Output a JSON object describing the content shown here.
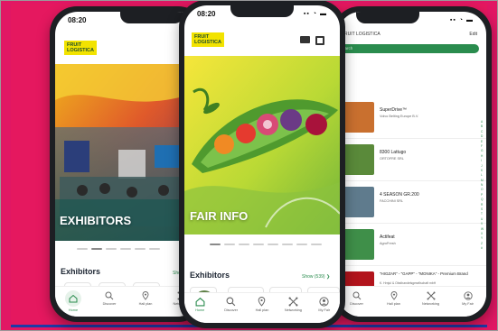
{
  "left_phone": {
    "time": "08:20",
    "logo": [
      "FRUIT",
      "LOGISTICA"
    ],
    "hero_title": "EXHIBITORS",
    "section_title": "Exhibitors",
    "show_link": "Show",
    "tabs": [
      {
        "label": "Home",
        "icon": "home-icon"
      },
      {
        "label": "Discover",
        "icon": "search-icon"
      },
      {
        "label": "Hall plan",
        "icon": "map-pin-icon"
      },
      {
        "label": "Networking",
        "icon": "networking-icon"
      }
    ]
  },
  "center_phone": {
    "time": "08:20",
    "logo": [
      "FRUIT",
      "LOGISTICA"
    ],
    "hero_title": "FAIR INFO",
    "section_title": "Exhibitors",
    "show_link": "Show (539) ❯",
    "tabs": [
      {
        "label": "Home",
        "icon": "home-icon"
      },
      {
        "label": "Discover",
        "icon": "search-icon"
      },
      {
        "label": "Hall plan",
        "icon": "map-pin-icon"
      },
      {
        "label": "Networking",
        "icon": "networking-icon"
      },
      {
        "label": "My Fair",
        "icon": "user-icon"
      }
    ]
  },
  "right_phone": {
    "header_title": "FRUIT LOGISTICA",
    "edit_label": "Edit",
    "search_label": "Search",
    "rows": [
      {
        "name": "SuperDrive™",
        "sub": "Volvo Belting Europe B.V.",
        "color": "#c9702f"
      },
      {
        "name": "8300 Lattugo",
        "sub": "ORTOFRE SRL",
        "color": "#5a8a3a"
      },
      {
        "name": "4 SEASON GR.200",
        "sub": "FACCHINI SRL",
        "color": "#5f7b8d"
      },
      {
        "name": "Actifeat",
        "sub": "AgroFresh",
        "color": "#3f8f49"
      },
      {
        "name": "\"HIGZAR\" - \"GAPP\" - \"MONIKA\" - Premium Brand",
        "sub": "K. Hrnjul & Obsthandelsgesellschaft mbH",
        "color": "#b2141c"
      }
    ],
    "alpha": [
      "A",
      "B",
      "C",
      "D",
      "E",
      "F",
      "G",
      "H",
      "I",
      "J",
      "K",
      "L",
      "M",
      "N",
      "O",
      "P",
      "Q",
      "R",
      "S",
      "T",
      "U",
      "V",
      "W",
      "X",
      "Y",
      "Z",
      "#"
    ],
    "tabs": [
      {
        "label": "Discover",
        "icon": "search-icon"
      },
      {
        "label": "Hall plan",
        "icon": "map-pin-icon"
      },
      {
        "label": "Networking",
        "icon": "networking-icon"
      },
      {
        "label": "My Fair",
        "icon": "user-icon"
      }
    ]
  },
  "colors": {
    "background": "#e5185f",
    "accent": "#2a8c4e",
    "logo_bg": "#f2e300"
  }
}
